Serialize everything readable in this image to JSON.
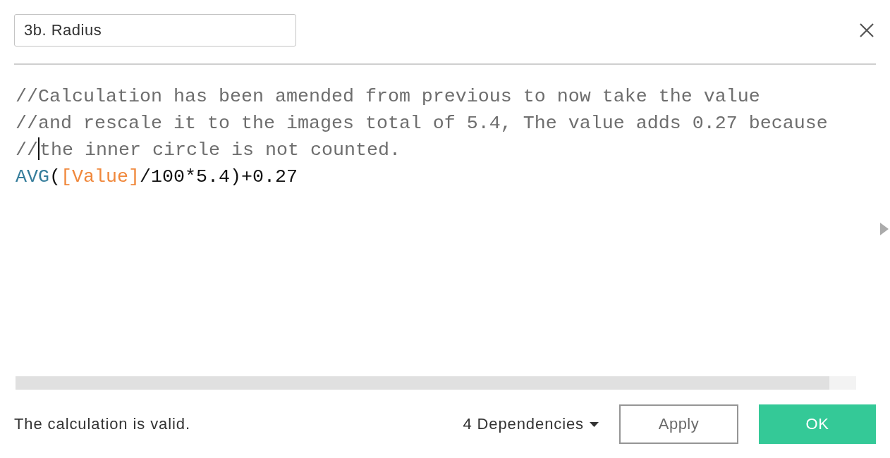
{
  "name_field": {
    "value": "3b. Radius"
  },
  "editor": {
    "lines": [
      {
        "segments": [
          {
            "kind": "comment",
            "text": "//Calculation has been amended from previous to now take the value"
          }
        ]
      },
      {
        "segments": [
          {
            "kind": "comment",
            "text": "//and rescale it to the images total of 5.4, The value adds 0.27 because"
          }
        ]
      },
      {
        "segments": [
          {
            "kind": "comment",
            "text": "//"
          },
          {
            "kind": "cursor"
          },
          {
            "kind": "comment",
            "text": "the inner circle is not counted."
          }
        ]
      },
      {
        "segments": [
          {
            "kind": "function",
            "text": "AVG"
          },
          {
            "kind": "text",
            "text": "("
          },
          {
            "kind": "field",
            "text": "[Value]"
          },
          {
            "kind": "text",
            "text": "/100*5.4)+0.27"
          }
        ]
      }
    ]
  },
  "footer": {
    "status": "The calculation is valid.",
    "dependencies": {
      "label": "4 Dependencies"
    },
    "buttons": [
      {
        "label": "Apply",
        "kind": "secondary"
      },
      {
        "label": "OK",
        "kind": "primary"
      }
    ]
  }
}
